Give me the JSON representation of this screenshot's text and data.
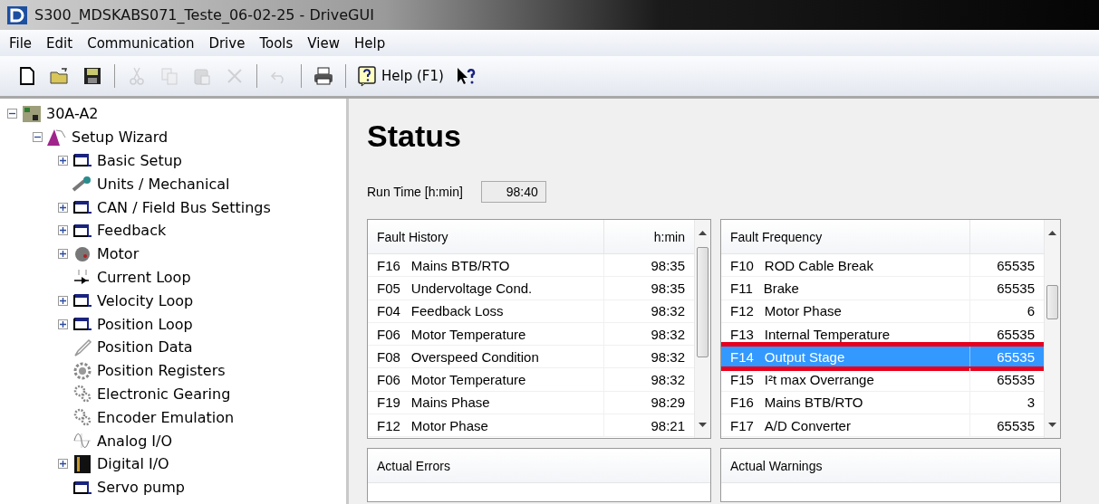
{
  "window": {
    "title": "S300_MDSKABS071_Teste_06-02-25 - DriveGUI"
  },
  "menu": [
    "File",
    "Edit",
    "Communication",
    "Drive",
    "Tools",
    "View",
    "Help"
  ],
  "toolbar": [
    {
      "kind": "icon",
      "disabled": false
    },
    {
      "kind": "icon",
      "disabled": false
    },
    {
      "kind": "icon",
      "disabled": false
    },
    {
      "kind": "sep"
    },
    {
      "kind": "icon",
      "disabled": true
    },
    {
      "kind": "icon",
      "disabled": true
    },
    {
      "kind": "icon",
      "disabled": true
    },
    {
      "kind": "icon",
      "disabled": true
    },
    {
      "kind": "sep"
    },
    {
      "kind": "icon",
      "disabled": true
    },
    {
      "kind": "sep"
    },
    {
      "kind": "icon",
      "disabled": false
    },
    {
      "kind": "sep"
    },
    {
      "kind": "help",
      "label": "Help (F1)"
    },
    {
      "kind": "icon",
      "disabled": false
    }
  ],
  "tree": [
    {
      "label": "30A-A2",
      "kind": "device",
      "expanded": true,
      "children": [
        {
          "label": "Setup Wizard",
          "kind": "wizard",
          "expanded": true,
          "children": [
            {
              "label": "Basic Setup",
              "kind": "window",
              "expanded": false
            },
            {
              "label": "Units / Mechanical",
              "kind": "mech"
            },
            {
              "label": "CAN / Field Bus Settings",
              "kind": "window",
              "expanded": false
            },
            {
              "label": "Feedback",
              "kind": "window",
              "expanded": false
            },
            {
              "label": "Motor",
              "kind": "motor",
              "expanded": false
            },
            {
              "label": "Current Loop",
              "kind": "current"
            },
            {
              "label": "Velocity Loop",
              "kind": "window",
              "expanded": false
            },
            {
              "label": "Position Loop",
              "kind": "window",
              "expanded": false
            },
            {
              "label": "Position Data",
              "kind": "pen"
            },
            {
              "label": "Position Registers",
              "kind": "gear"
            },
            {
              "label": "Electronic Gearing",
              "kind": "gears"
            },
            {
              "label": "Encoder Emulation",
              "kind": "gears"
            },
            {
              "label": "Analog I/O",
              "kind": "wave"
            },
            {
              "label": "Digital I/O",
              "kind": "digital",
              "expanded": false
            },
            {
              "label": "Servo pump",
              "kind": "window"
            }
          ]
        }
      ]
    }
  ],
  "status": {
    "heading": "Status",
    "run_time_label": "Run Time [h:min]",
    "run_time_value": "98:40"
  },
  "fault_history": {
    "columns": [
      "Fault History",
      "h:min"
    ],
    "rows": [
      {
        "code": "F16",
        "name": "Mains BTB/RTO",
        "value": "98:35",
        "selected": false
      },
      {
        "code": "F05",
        "name": "Undervoltage Cond.",
        "value": "98:35",
        "selected": false
      },
      {
        "code": "F04",
        "name": "Feedback Loss",
        "value": "98:32",
        "selected": false
      },
      {
        "code": "F06",
        "name": "Motor Temperature",
        "value": "98:32",
        "selected": false
      },
      {
        "code": "F08",
        "name": "Overspeed Condition",
        "value": "98:32",
        "selected": false
      },
      {
        "code": "F06",
        "name": "Motor Temperature",
        "value": "98:32",
        "selected": false
      },
      {
        "code": "F19",
        "name": "Mains Phase",
        "value": "98:29",
        "selected": false
      },
      {
        "code": "F12",
        "name": "Motor Phase",
        "value": "98:21",
        "selected": false
      }
    ]
  },
  "fault_frequency": {
    "columns": [
      "Fault Frequency"
    ],
    "rows": [
      {
        "code": "F10",
        "name": "ROD Cable Break",
        "value": "65535",
        "selected": false,
        "outlined": false
      },
      {
        "code": "F11",
        "name": "Brake",
        "value": "65535",
        "selected": false,
        "outlined": false
      },
      {
        "code": "F12",
        "name": "Motor Phase",
        "value": "6",
        "selected": false,
        "outlined": false
      },
      {
        "code": "F13",
        "name": "Internal Temperature",
        "value": "65535",
        "selected": false,
        "outlined": false
      },
      {
        "code": "F14",
        "name": "Output Stage",
        "value": "65535",
        "selected": true,
        "outlined": true
      },
      {
        "code": "F15",
        "name": "I²t max Overrange",
        "value": "65535",
        "selected": false,
        "outlined": false
      },
      {
        "code": "F16",
        "name": "Mains BTB/RTO",
        "value": "3",
        "selected": false,
        "outlined": false
      },
      {
        "code": "F17",
        "name": "A/D Converter",
        "value": "65535",
        "selected": false,
        "outlined": false
      }
    ]
  },
  "actual_errors": {
    "title": "Actual Errors"
  },
  "actual_warnings": {
    "title": "Actual Warnings"
  }
}
